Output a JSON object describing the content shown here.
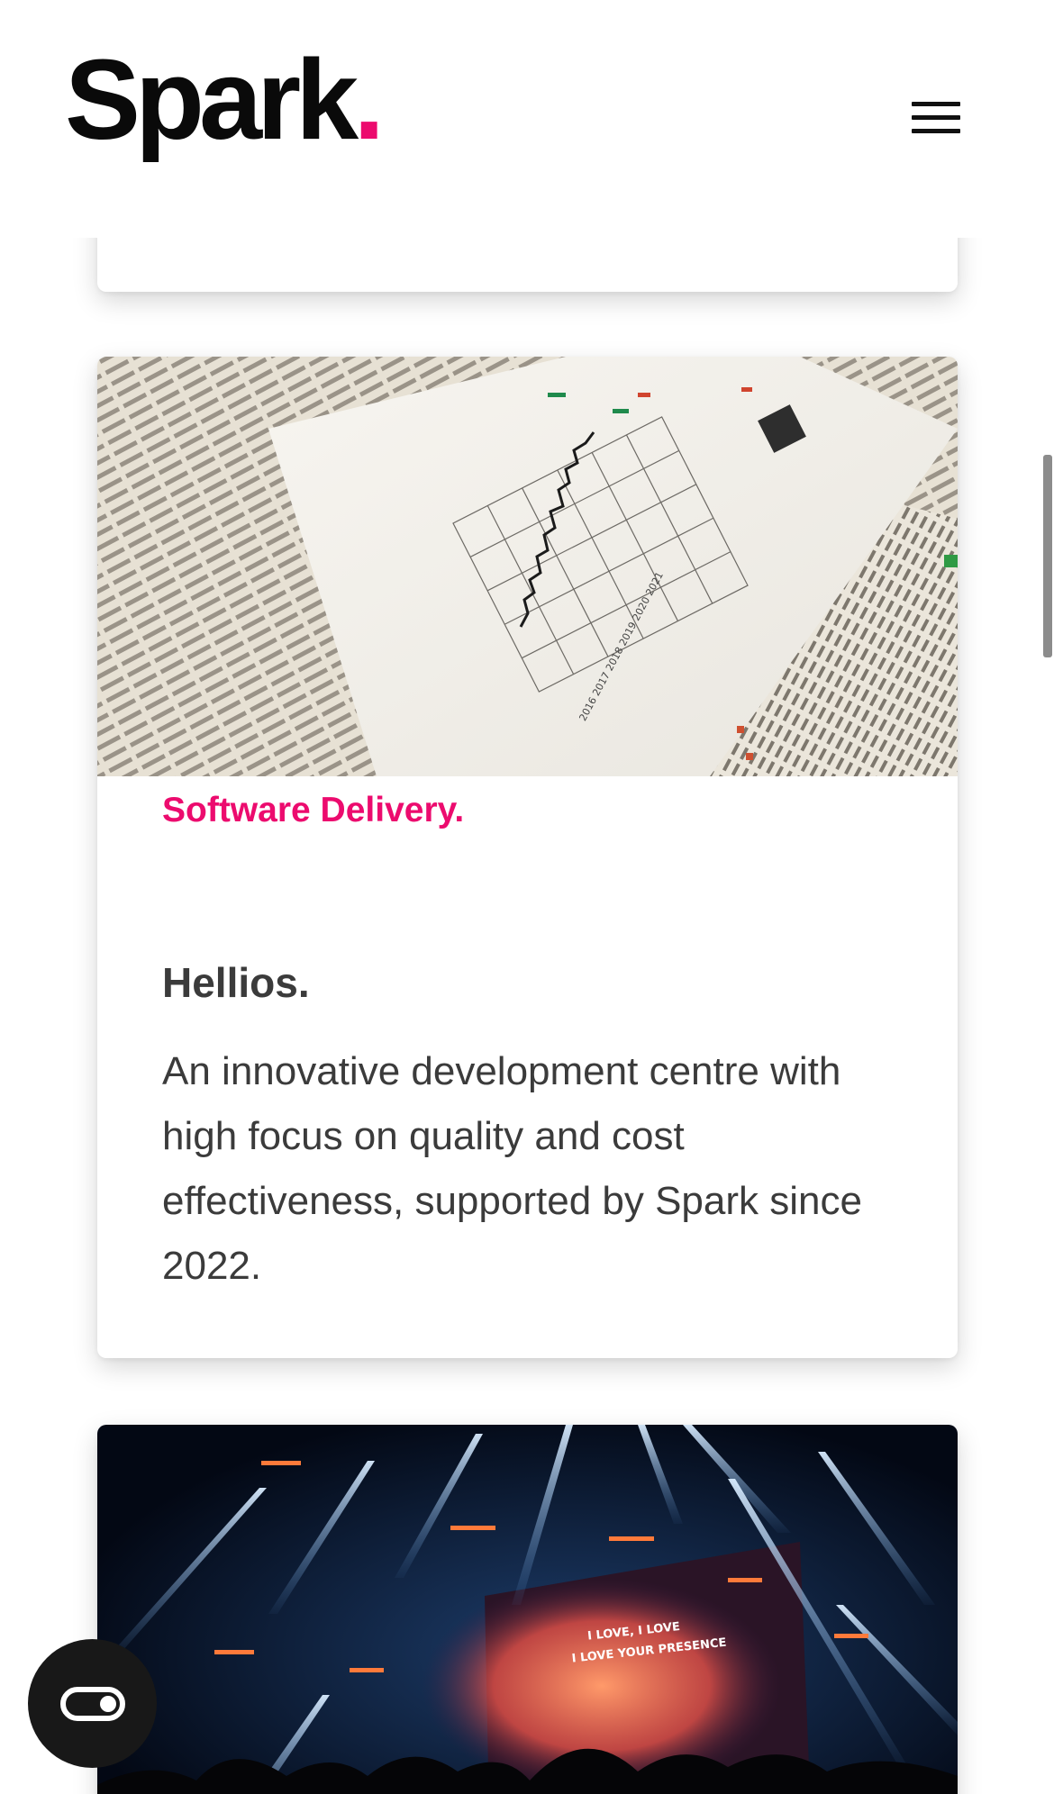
{
  "brand": {
    "name": "Spark",
    "dot": ".",
    "accent_color": "#ec0b6e"
  },
  "header": {
    "menu_icon": "hamburger-menu-icon"
  },
  "cards": [
    {
      "category": "Software Delivery.",
      "title": "Hellios.",
      "description": "An innovative development centre with high focus on quality and cost effectiveness, supported by Spark since 2022.",
      "image": "newspaper-stock-chart-photo"
    },
    {
      "image": "concert-stage-lights-photo",
      "screen_text": [
        "I LOVE, I LOVE",
        "I LOVE YOUR PRESENCE"
      ]
    }
  ],
  "floating_button": {
    "icon": "accessibility-toggle-icon"
  }
}
